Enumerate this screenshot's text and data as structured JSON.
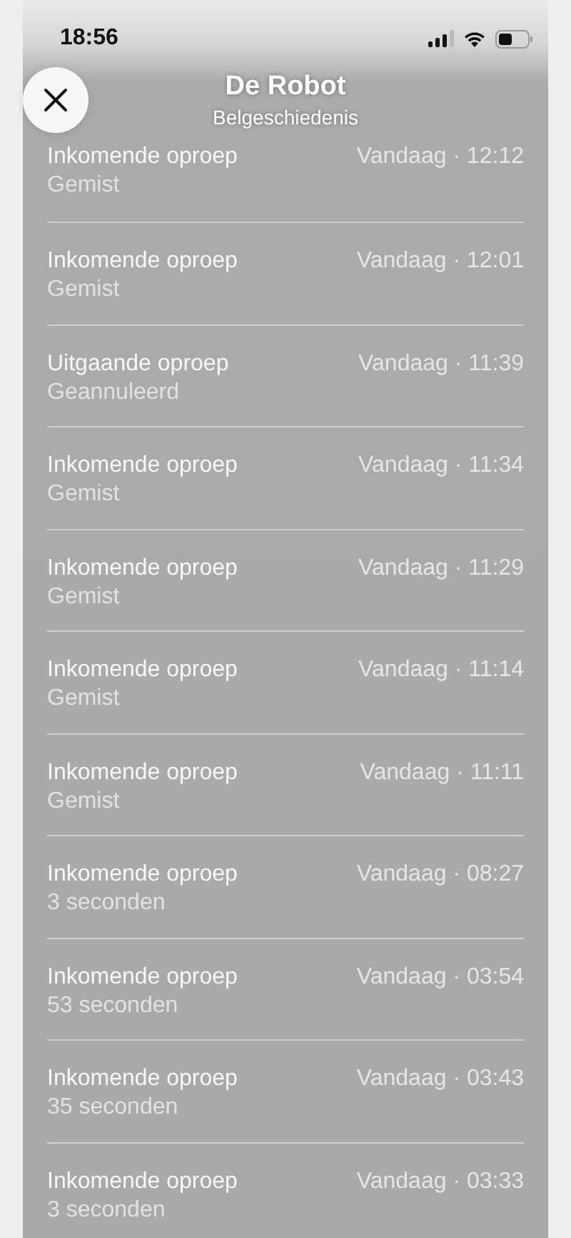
{
  "status_bar": {
    "time": "18:56"
  },
  "header": {
    "title": "De Robot",
    "subtitle": "Belgeschiedenis"
  },
  "calls": [
    {
      "title": "Inkomende oproep",
      "detail": "Gemist",
      "time": "Vandaag · 12:12"
    },
    {
      "title": "Inkomende oproep",
      "detail": "Gemist",
      "time": "Vandaag · 12:01"
    },
    {
      "title": "Uitgaande oproep",
      "detail": "Geannuleerd",
      "time": "Vandaag · 11:39"
    },
    {
      "title": "Inkomende oproep",
      "detail": "Gemist",
      "time": "Vandaag · 11:34"
    },
    {
      "title": "Inkomende oproep",
      "detail": "Gemist",
      "time": "Vandaag · 11:29"
    },
    {
      "title": "Inkomende oproep",
      "detail": "Gemist",
      "time": "Vandaag · 11:14"
    },
    {
      "title": "Inkomende oproep",
      "detail": "Gemist",
      "time": "Vandaag · 11:11"
    },
    {
      "title": "Inkomende oproep",
      "detail": "3 seconden",
      "time": "Vandaag · 08:27"
    },
    {
      "title": "Inkomende oproep",
      "detail": "53 seconden",
      "time": "Vandaag · 03:54"
    },
    {
      "title": "Inkomende oproep",
      "detail": "35 seconden",
      "time": "Vandaag · 03:43"
    },
    {
      "title": "Inkomende oproep",
      "detail": "3 seconden",
      "time": "Vandaag · 03:33"
    }
  ]
}
